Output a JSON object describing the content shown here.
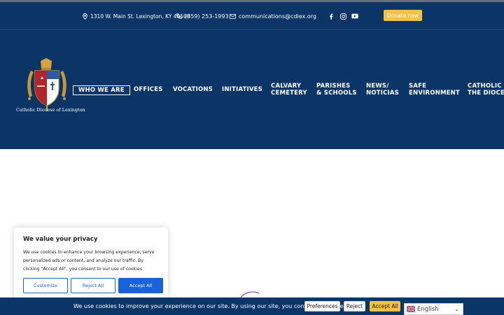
{
  "contact": {
    "address": "1310 W. Main St. Lexington, KY 40508",
    "phone": "(859) 253-1993",
    "email": "communications@cdlex.org"
  },
  "social": [
    "facebook-icon",
    "instagram-icon",
    "youtube-icon"
  ],
  "donate_label": "Donate now",
  "logo_caption": "Catholic Diocese of Lexington",
  "nav": {
    "who_we_are": "WHO WE ARE",
    "offices": "OFFICES",
    "vocations": "VOCATIONS",
    "initiatives": "INITIATIVES",
    "calvary_1": "CALVARY",
    "calvary_2": "CEMETERY",
    "parishes_1": "PARISHES",
    "parishes_2": "& SCHOOLS",
    "news_1": "NEWS/",
    "news_2": "NOTICIAS",
    "safe_1": "SAFE",
    "safe_2": "ENVIRONMENT",
    "catholic_1": "CATHOLIC C",
    "catholic_2": "THE DIOCES"
  },
  "cookie_card": {
    "title": "We value your privacy",
    "text": "We use cookies to enhance your browsing experience, serve personalized ads or content, and analyze our traffic. By clicking \"Accept All\", you consent to our use of cookies.",
    "customize": "Customize",
    "reject": "Reject All",
    "accept": "Accept All"
  },
  "cookie_bar": {
    "message": "We use cookies to improve your experience on our site. By using our site, you consent to cookies.",
    "preferences": "Preferences",
    "reject": "Reject",
    "accept": "Accept All"
  },
  "language": "English",
  "colors": {
    "navy": "#0b3566",
    "gold": "#f3c243",
    "cookie_blue": "#1863dc"
  }
}
